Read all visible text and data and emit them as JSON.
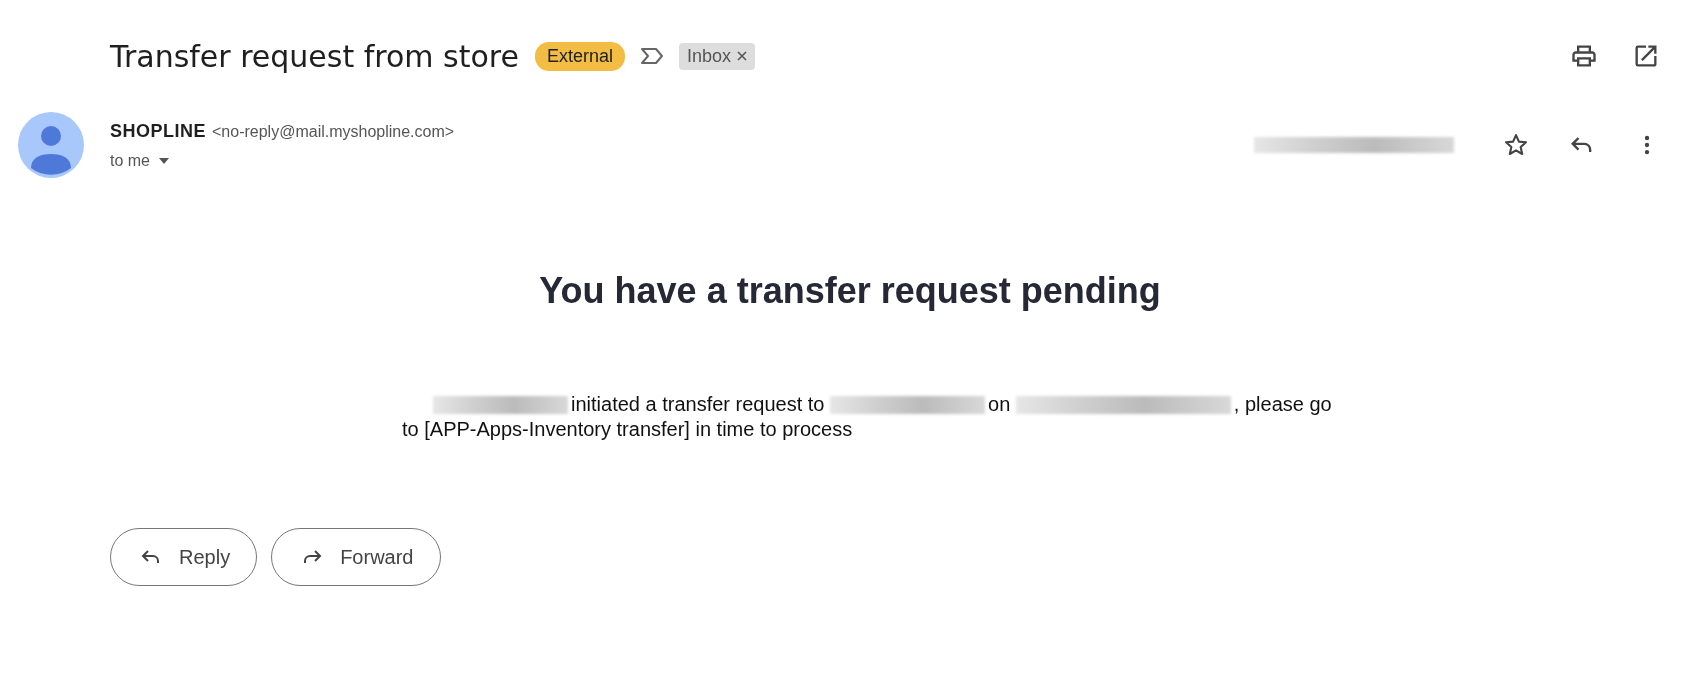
{
  "subject": "Transfer request from store",
  "labels": [
    {
      "text": "External",
      "kind": "tag"
    },
    {
      "text": "Inbox",
      "kind": "removable"
    }
  ],
  "sender": {
    "name": "SHOPLINE",
    "email": "<no-reply@mail.myshopline.com>",
    "recipient": "to me"
  },
  "message": {
    "heading": "You have a transfer request pending",
    "segments": [
      {
        "kind": "redacted"
      },
      {
        "kind": "text",
        "text": "initiated a transfer request to"
      },
      {
        "kind": "redacted"
      },
      {
        "kind": "text",
        "text": "on"
      },
      {
        "kind": "redacted"
      },
      {
        "kind": "text",
        "text": ", please go"
      },
      {
        "kind": "line",
        "text": "to [APP-Apps-Inventory transfer] in time to process"
      }
    ]
  },
  "actions": [
    "Reply",
    "Forward"
  ]
}
